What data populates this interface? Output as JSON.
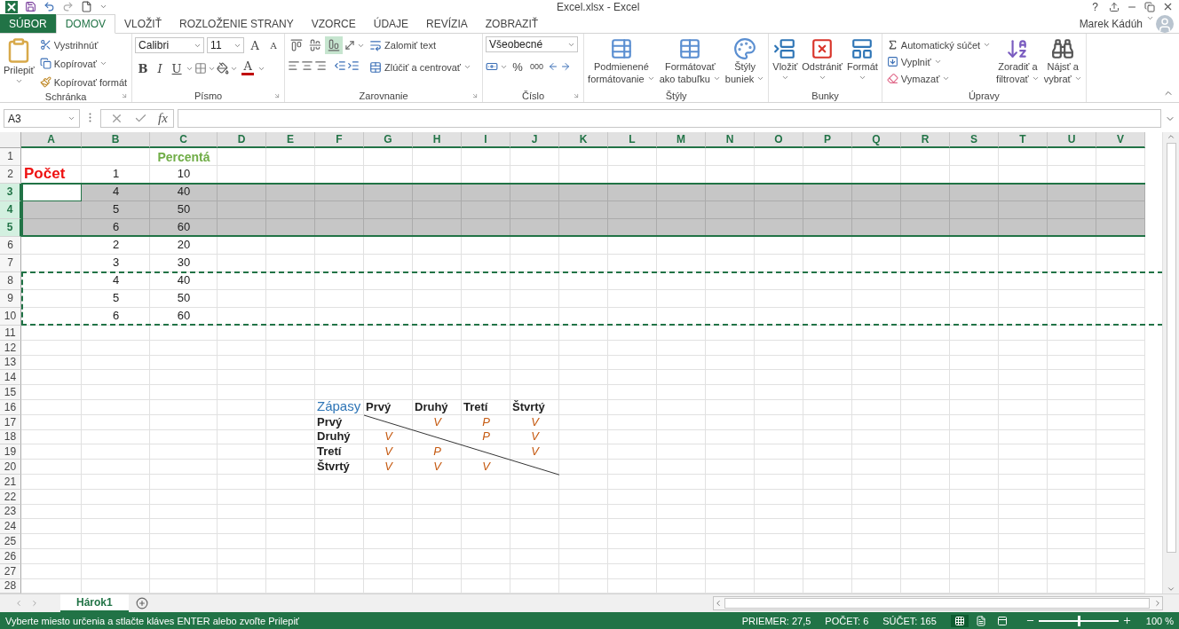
{
  "title_bar": {
    "title": "Excel.xlsx - Excel",
    "help": "?",
    "user": "Marek Kádúh"
  },
  "tabs": [
    {
      "label": "SÚBOR",
      "kind": "file",
      "selected": false
    },
    {
      "label": "DOMOV",
      "kind": "tab",
      "selected": true
    },
    {
      "label": "VLOŽIŤ",
      "kind": "tab",
      "selected": false
    },
    {
      "label": "ROZLOŽENIE STRANY",
      "kind": "tab",
      "selected": false
    },
    {
      "label": "VZORCE",
      "kind": "tab",
      "selected": false
    },
    {
      "label": "ÚDAJE",
      "kind": "tab",
      "selected": false
    },
    {
      "label": "REVÍZIA",
      "kind": "tab",
      "selected": false
    },
    {
      "label": "ZOBRAZIŤ",
      "kind": "tab",
      "selected": false
    }
  ],
  "ribbon": {
    "clipboard": {
      "label": "Schránka",
      "paste": "Prilepiť",
      "cut": "Vystrihnúť",
      "copy": "Kopírovať",
      "format_painter": "Kopírovať formát"
    },
    "font": {
      "label": "Písmo",
      "font_name": "Calibri",
      "font_size": "11",
      "grow": "A",
      "shrink": "A",
      "bold": "B",
      "italic": "I",
      "underline": "U",
      "font_color": "A"
    },
    "alignment": {
      "label": "Zarovnanie",
      "vertical": [
        {
          "selected": false
        },
        {
          "selected": false
        },
        {
          "selected": true
        }
      ],
      "wrap_text": "Zalomiť text",
      "merge": "Zlúčiť a centrovať"
    },
    "number": {
      "label": "Číslo",
      "format": "Všeobecné",
      "percent": "%",
      "thousands": "000"
    },
    "styles": {
      "label": "Štýly",
      "buttons": [
        {
          "kind": "conditional",
          "lines": [
            "Podmienené",
            "formátovanie"
          ]
        },
        {
          "kind": "table",
          "lines": [
            "Formátovať",
            "ako tabuľku"
          ]
        },
        {
          "kind": "cell",
          "lines": [
            "Štýly",
            "buniek"
          ]
        }
      ]
    },
    "cells": {
      "label": "Bunky",
      "buttons": [
        {
          "kind": "insert",
          "label": "Vložiť"
        },
        {
          "kind": "delete",
          "label": "Odstrániť"
        },
        {
          "kind": "format",
          "label": "Formát"
        }
      ]
    },
    "editing": {
      "label": "Úpravy",
      "autosum": "Automatický súčet",
      "fill": "Vyplniť",
      "clear": "Vymazať",
      "sort": [
        "Zoradiť a",
        "filtrovať"
      ],
      "find": [
        "Nájsť a",
        "vybrať"
      ]
    }
  },
  "formula_bar": {
    "name_box": "A3",
    "function_label": "fx"
  },
  "grid": {
    "columns": [
      {
        "label": "A",
        "selected": true
      },
      {
        "label": "B",
        "selected": true
      },
      {
        "label": "C",
        "selected": true
      },
      {
        "label": "D",
        "selected": true
      },
      {
        "label": "E",
        "selected": true
      },
      {
        "label": "F",
        "selected": true
      },
      {
        "label": "G",
        "selected": true
      },
      {
        "label": "H",
        "selected": true
      },
      {
        "label": "I",
        "selected": true
      },
      {
        "label": "J",
        "selected": true
      },
      {
        "label": "K",
        "selected": true
      },
      {
        "label": "L",
        "selected": true
      },
      {
        "label": "M",
        "selected": true
      },
      {
        "label": "N",
        "selected": true
      },
      {
        "label": "O",
        "selected": true
      },
      {
        "label": "P",
        "selected": true
      },
      {
        "label": "Q",
        "selected": true
      },
      {
        "label": "R",
        "selected": true
      },
      {
        "label": "S",
        "selected": true
      },
      {
        "label": "T",
        "selected": true
      },
      {
        "label": "U",
        "selected": true
      },
      {
        "label": "V",
        "selected": true
      }
    ],
    "rows": [
      {
        "label": "1",
        "selected": false,
        "copied": false,
        "cells": [
          null,
          null,
          {
            "text": "Percentá",
            "kind": "heading",
            "active": false
          }
        ]
      },
      {
        "label": "2",
        "selected": false,
        "copied": false,
        "cells": [
          {
            "text": "Počet",
            "kind": "title",
            "active": false
          },
          {
            "text": "1",
            "kind": "number",
            "active": false
          },
          {
            "text": "10",
            "kind": "number",
            "active": false
          }
        ]
      },
      {
        "label": "3",
        "selected": true,
        "copied": false,
        "cells": [
          {
            "kind": "empty",
            "active": true
          },
          {
            "text": "4",
            "kind": "number",
            "active": false
          },
          {
            "text": "40",
            "kind": "number",
            "active": false
          }
        ]
      },
      {
        "label": "4",
        "selected": true,
        "copied": false,
        "cells": [
          null,
          {
            "text": "5",
            "kind": "number",
            "active": false
          },
          {
            "text": "50",
            "kind": "number",
            "active": false
          }
        ]
      },
      {
        "label": "5",
        "selected": true,
        "copied": false,
        "cells": [
          null,
          {
            "text": "6",
            "kind": "number",
            "active": false
          },
          {
            "text": "60",
            "kind": "number",
            "active": false
          }
        ]
      },
      {
        "label": "6",
        "selected": false,
        "copied": false,
        "cells": [
          null,
          {
            "text": "2",
            "kind": "number",
            "active": false
          },
          {
            "text": "20",
            "kind": "number",
            "active": false
          }
        ]
      },
      {
        "label": "7",
        "selected": false,
        "copied": false,
        "cells": [
          null,
          {
            "text": "3",
            "kind": "number",
            "active": false
          },
          {
            "text": "30",
            "kind": "number",
            "active": false
          }
        ]
      },
      {
        "label": "8",
        "selected": false,
        "copied": true,
        "cells": [
          null,
          {
            "text": "4",
            "kind": "number",
            "active": false
          },
          {
            "text": "40",
            "kind": "number",
            "active": false
          }
        ]
      },
      {
        "label": "9",
        "selected": false,
        "copied": true,
        "cells": [
          null,
          {
            "text": "5",
            "kind": "number",
            "active": false
          },
          {
            "text": "50",
            "kind": "number",
            "active": false
          }
        ]
      },
      {
        "label": "10",
        "selected": false,
        "copied": true,
        "cells": [
          null,
          {
            "text": "6",
            "kind": "number",
            "active": false
          },
          {
            "text": "60",
            "kind": "number",
            "active": false
          }
        ]
      },
      {
        "label": "11",
        "selected": false,
        "copied": false,
        "cells": []
      },
      {
        "label": "12",
        "selected": false,
        "copied": false,
        "cells": []
      },
      {
        "label": "13",
        "selected": false,
        "copied": false,
        "cells": []
      },
      {
        "label": "14",
        "selected": false,
        "copied": false,
        "cells": []
      },
      {
        "label": "15",
        "selected": false,
        "copied": false,
        "cells": []
      },
      {
        "label": "16",
        "selected": false,
        "copied": false,
        "cells": [
          null,
          null,
          null,
          null,
          null,
          {
            "text": "Zápasy",
            "kind": "table-title",
            "active": false
          },
          {
            "text": "Prvý",
            "kind": "label",
            "active": false
          },
          {
            "text": "Druhý",
            "kind": "label",
            "active": false
          },
          {
            "text": "Tretí",
            "kind": "label",
            "active": false
          },
          {
            "text": "Štvrtý",
            "kind": "label",
            "active": false
          }
        ]
      },
      {
        "label": "17",
        "selected": false,
        "copied": false,
        "cells": [
          null,
          null,
          null,
          null,
          null,
          {
            "text": "Prvý",
            "kind": "label",
            "active": false
          },
          null,
          {
            "text": "V",
            "kind": "result",
            "active": false
          },
          {
            "text": "P",
            "kind": "result",
            "active": false
          },
          {
            "text": "V",
            "kind": "result",
            "active": false
          }
        ]
      },
      {
        "label": "18",
        "selected": false,
        "copied": false,
        "cells": [
          null,
          null,
          null,
          null,
          null,
          {
            "text": "Druhý",
            "kind": "label",
            "active": false
          },
          {
            "text": "V",
            "kind": "result",
            "active": false
          },
          null,
          {
            "text": "P",
            "kind": "result",
            "active": false
          },
          {
            "text": "V",
            "kind": "result",
            "active": false
          }
        ]
      },
      {
        "label": "19",
        "selected": false,
        "copied": false,
        "cells": [
          null,
          null,
          null,
          null,
          null,
          {
            "text": "Tretí",
            "kind": "label",
            "active": false
          },
          {
            "text": "V",
            "kind": "result",
            "active": false
          },
          {
            "text": "P",
            "kind": "result",
            "active": false
          },
          null,
          {
            "text": "V",
            "kind": "result",
            "active": false
          }
        ]
      },
      {
        "label": "20",
        "selected": false,
        "copied": false,
        "cells": [
          null,
          null,
          null,
          null,
          null,
          {
            "text": "Štvrtý",
            "kind": "label",
            "active": false
          },
          {
            "text": "V",
            "kind": "result",
            "active": false
          },
          {
            "text": "V",
            "kind": "result",
            "active": false
          },
          {
            "text": "V",
            "kind": "result",
            "active": false
          }
        ]
      },
      {
        "label": "21",
        "selected": false,
        "copied": false,
        "cells": []
      },
      {
        "label": "22",
        "selected": false,
        "copied": false,
        "cells": []
      },
      {
        "label": "23",
        "selected": false,
        "copied": false,
        "cells": []
      },
      {
        "label": "24",
        "selected": false,
        "copied": false,
        "cells": []
      },
      {
        "label": "25",
        "selected": false,
        "copied": false,
        "cells": []
      },
      {
        "label": "26",
        "selected": false,
        "copied": false,
        "cells": []
      },
      {
        "label": "27",
        "selected": false,
        "copied": false,
        "cells": []
      },
      {
        "label": "28",
        "selected": false,
        "copied": false,
        "cells": []
      }
    ]
  },
  "sheets": [
    {
      "label": "Hárok1",
      "selected": true
    }
  ],
  "status_bar": {
    "message": "Vyberte miesto určenia a stlačte kláves ENTER alebo zvoľte Prilepiť",
    "average": "PRIEMER: 27,5",
    "count": "POČET: 6",
    "sum": "SÚČET: 165",
    "views": [
      {
        "kind": "normal",
        "selected": true
      },
      {
        "kind": "layout",
        "selected": false
      },
      {
        "kind": "break",
        "selected": false
      }
    ],
    "zoom": {
      "level": 0.5,
      "reading": "100 %"
    }
  }
}
